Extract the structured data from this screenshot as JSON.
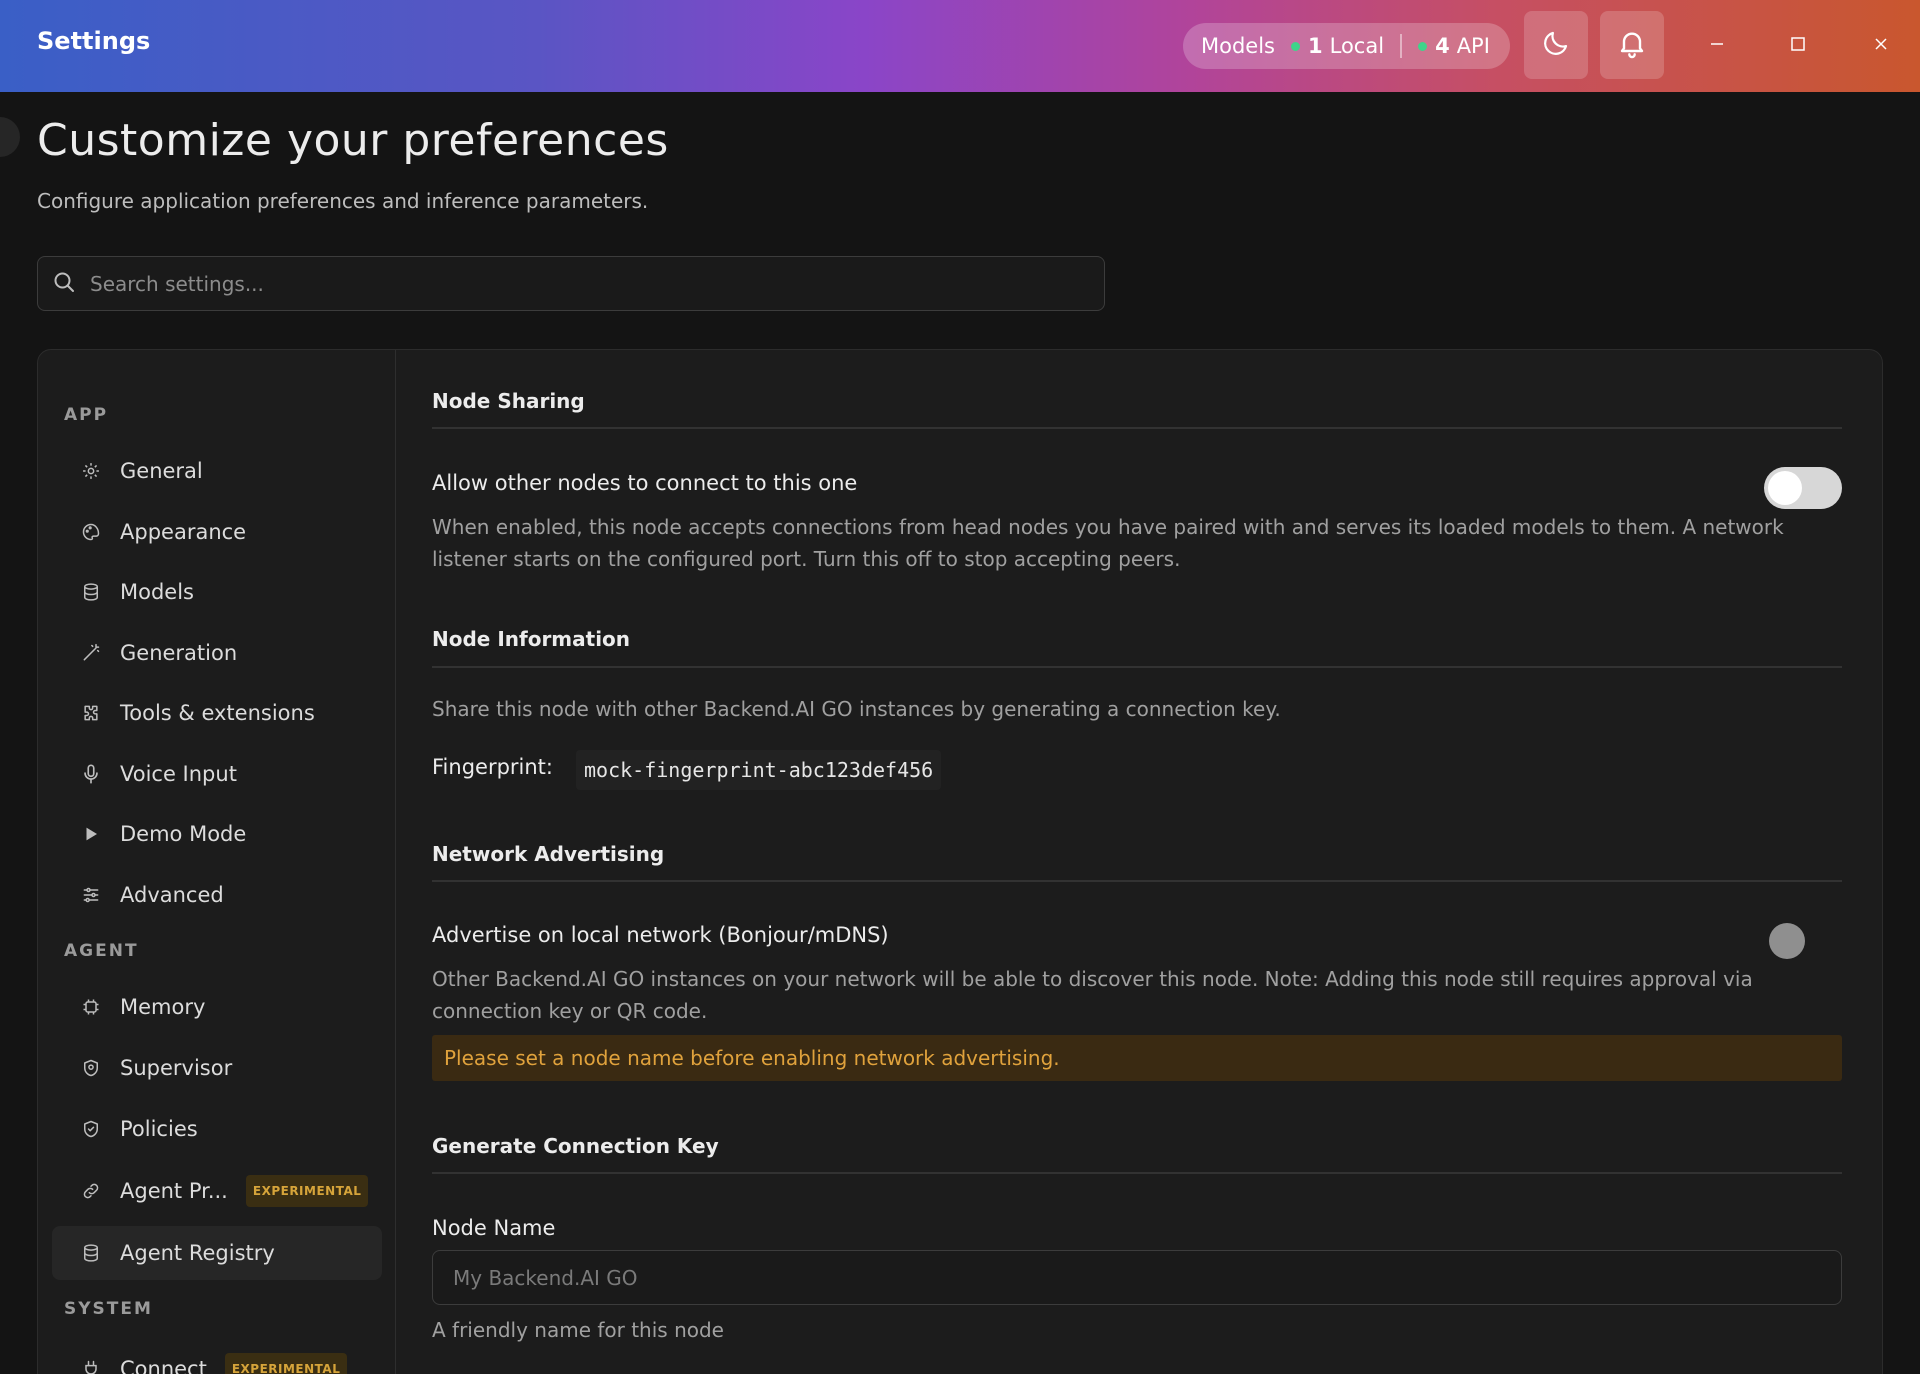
{
  "titlebar": {
    "title": "Settings",
    "models_label": "Models",
    "local_count": "1",
    "local_label": "Local",
    "api_count": "4",
    "api_label": "API",
    "status_dot_color": "#3fd48a"
  },
  "header": {
    "title": "Customize your preferences",
    "subtitle": "Configure application preferences and inference parameters.",
    "search_placeholder": "Search settings..."
  },
  "sidebar": {
    "app_label": "APP",
    "agent_label": "AGENT",
    "system_label": "SYSTEM",
    "app_items": [
      {
        "label": "General",
        "icon": "gear-icon"
      },
      {
        "label": "Appearance",
        "icon": "palette-icon"
      },
      {
        "label": "Models",
        "icon": "database-icon"
      },
      {
        "label": "Generation",
        "icon": "wand-icon"
      },
      {
        "label": "Tools & extensions",
        "icon": "puzzle-icon"
      },
      {
        "label": "Voice Input",
        "icon": "microphone-icon"
      },
      {
        "label": "Demo Mode",
        "icon": "play-icon"
      },
      {
        "label": "Advanced",
        "icon": "sliders-icon"
      }
    ],
    "agent_items": [
      {
        "label": "Memory",
        "icon": "chip-icon"
      },
      {
        "label": "Supervisor",
        "icon": "shield-icon"
      },
      {
        "label": "Policies",
        "icon": "shield-check-icon"
      },
      {
        "label": "Agent Pr...",
        "icon": "link-icon",
        "badge": "EXPERIMENTAL"
      },
      {
        "label": "Agent Registry",
        "icon": "database-icon",
        "active": true
      }
    ],
    "system_items": [
      {
        "label": "Connect",
        "icon": "plug-icon",
        "badge": "EXPERIMENTAL"
      }
    ]
  },
  "content": {
    "node_sharing": {
      "heading": "Node Sharing",
      "allow_title": "Allow other nodes to connect to this one",
      "allow_desc_1": "When enabled, this node accepts connections from head nodes you have paired with and serves its loaded models to them. A network",
      "allow_desc_2": "listener starts on the configured port. Turn this off to stop accepting peers.",
      "allow_enabled": false
    },
    "node_info": {
      "heading": "Node Information",
      "desc": "Share this node with other Backend.AI GO instances by generating a connection key.",
      "fingerprint_label": "Fingerprint:",
      "fingerprint_value": "mock-fingerprint-abc123def456"
    },
    "network_advertising": {
      "heading": "Network Advertising",
      "advertise_title": "Advertise on local network (Bonjour/mDNS)",
      "advertise_desc_1": "Other Backend.AI GO instances on your network will be able to discover this node. Note: Adding this node still requires approval via",
      "advertise_desc_2": "connection key or QR code.",
      "warning": "Please set a node name before enabling network advertising.",
      "advertise_enabled": false
    },
    "connection_key": {
      "heading": "Generate Connection Key",
      "node_name_label": "Node Name",
      "node_name_placeholder": "My Backend.AI GO",
      "node_name_value": "",
      "node_name_hint": "A friendly name for this node"
    }
  }
}
